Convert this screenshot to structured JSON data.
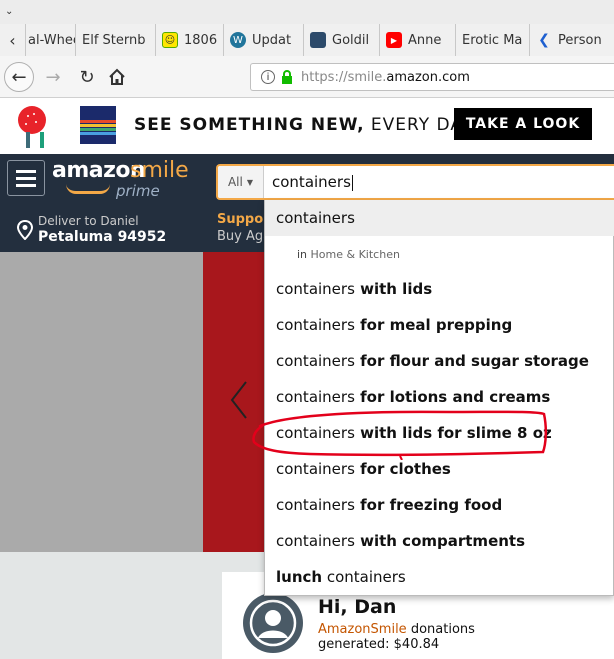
{
  "browser": {
    "tabs": [
      {
        "label": "al-Whee",
        "icon": "page-icon"
      },
      {
        "label": "Elf Sternb",
        "icon": "page-icon"
      },
      {
        "label": "1806",
        "icon": "smiley-icon"
      },
      {
        "label": "Updat",
        "icon": "wordpress-icon"
      },
      {
        "label": "Goldil",
        "icon": "image-icon"
      },
      {
        "label": "Anne",
        "icon": "youtube-icon"
      },
      {
        "label": "Erotic Ma",
        "icon": "page-icon"
      },
      {
        "label": "Person",
        "icon": "arrow-icon"
      }
    ],
    "url_prefix": "https://smile.",
    "url_domain": "amazon.com"
  },
  "banner": {
    "tagline_bold": "SEE SOMETHING NEW,",
    "tagline_rest": " EVERY DAY.",
    "cta": "TAKE A LOOK"
  },
  "header": {
    "logo_main": "amazon",
    "logo_smile": "smile",
    "logo_prime": "prime",
    "deliver_line1": "Deliver to Daniel",
    "deliver_line2": "Petaluma 94952",
    "support_line1": "Support",
    "support_line2": "Buy Aga"
  },
  "search": {
    "category": "All",
    "query": "containers"
  },
  "suggestions": [
    {
      "prefix": "containers",
      "bold": ""
    },
    {
      "dept_in": "in",
      "dept": "Home & Kitchen"
    },
    {
      "prefix": "containers",
      "bold": " with lids"
    },
    {
      "prefix": "containers",
      "bold": " for meal prepping"
    },
    {
      "prefix": "containers",
      "bold": " for flour and sugar storage"
    },
    {
      "prefix": "containers",
      "bold": " for lotions and creams"
    },
    {
      "prefix": "containers",
      "bold": " with lids for slime 8 oz"
    },
    {
      "prefix": "containers",
      "bold": " for clothes"
    },
    {
      "prefix": "containers",
      "bold": " for freezing food"
    },
    {
      "prefix": "containers",
      "bold": " with compartments"
    },
    {
      "prefix": "lunch",
      "bold": " containers",
      "bold_first": true
    }
  ],
  "account": {
    "greeting": "Hi, Dan",
    "amazonsmile": "AmazonSmile",
    "donations": " donations",
    "generated": "generated: $40.84"
  },
  "colors": {
    "amazon_dark": "#232f3e",
    "amazon_orange": "#f3a847",
    "highlight_red": "#e3001b"
  }
}
